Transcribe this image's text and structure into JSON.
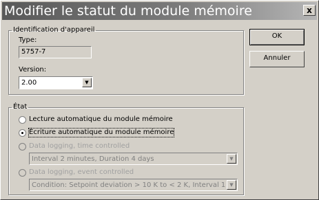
{
  "window": {
    "title": "Modifier le statut du module mémoire",
    "close_label": "x"
  },
  "identification": {
    "legend": "Identification d'appareil",
    "type_label": "Type:",
    "type_value": "5757-7",
    "version_label": "Version:",
    "version_value": "2.00"
  },
  "state": {
    "legend": "État",
    "options": [
      {
        "label": "Lecture automatique du module mémoire",
        "selected": false,
        "enabled": true
      },
      {
        "label": "Écriture automatique du module mémoire",
        "selected": true,
        "enabled": true
      },
      {
        "label": "Data logging, time controlled",
        "selected": false,
        "enabled": false
      },
      {
        "label": "Data logging, event controlled",
        "selected": false,
        "enabled": false
      }
    ],
    "time_interval_value": "Interval 2 minutes, Duration 4 days",
    "event_condition_value": "Condition: Setpoint deviation > 10 K to < 2 K, Interval 1 m"
  },
  "buttons": {
    "ok_label": "OK",
    "cancel_label": "Annuler"
  },
  "icons": {
    "dropdown": "chevron-down-icon",
    "close": "close-icon"
  }
}
